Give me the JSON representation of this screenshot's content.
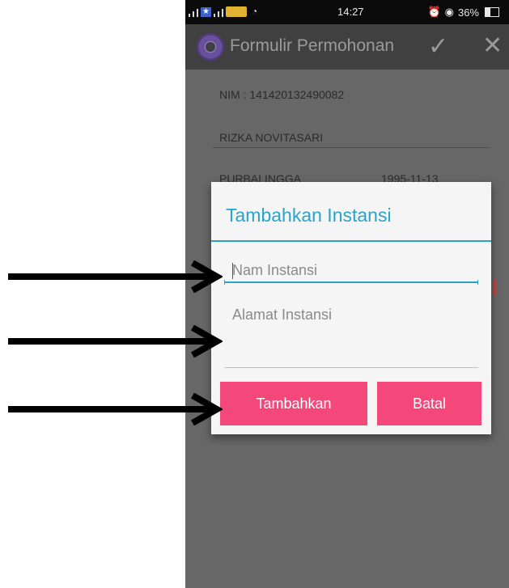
{
  "status_bar": {
    "time": "14:27",
    "battery": "36%",
    "battery_level": 0.36
  },
  "app_bar": {
    "title": "Formulir Permohonan",
    "confirm_icon": "check-icon",
    "close_icon": "close-icon"
  },
  "form": {
    "nim": "NIM : 141420132490082",
    "name": "RIZKA NOVITASARI",
    "birthplace": "PURBALINGGA",
    "birthdate": "1995-11-13"
  },
  "dialog": {
    "title": "Tambahkan Instansi",
    "name_placeholder": "Nam Instansi",
    "address_placeholder": "Alamat Instansi",
    "add_label": "Tambahkan",
    "cancel_label": "Batal"
  },
  "colors": {
    "accent": "#2aa3c9",
    "button": "#f4477a",
    "overlay": "#676767",
    "app_bar": "#404040"
  }
}
